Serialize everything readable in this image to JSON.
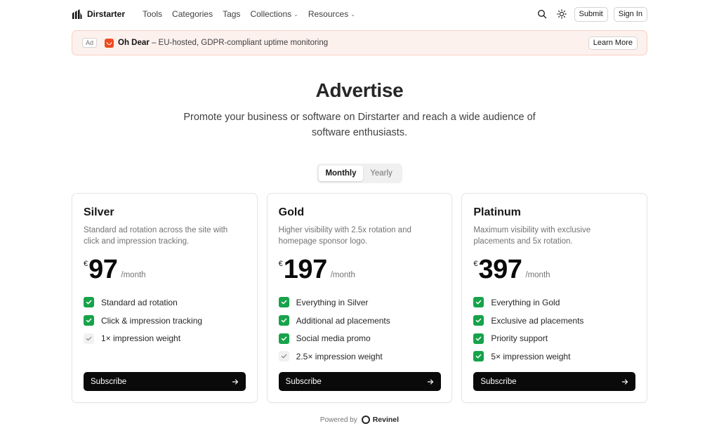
{
  "header": {
    "brand": "Dirstarter",
    "nav": [
      {
        "label": "Tools",
        "dropdown": false
      },
      {
        "label": "Categories",
        "dropdown": false
      },
      {
        "label": "Tags",
        "dropdown": false
      },
      {
        "label": "Collections",
        "dropdown": true
      },
      {
        "label": "Resources",
        "dropdown": true
      }
    ],
    "submit_label": "Submit",
    "signin_label": "Sign In",
    "icons": [
      "search-icon",
      "theme-sun-icon"
    ]
  },
  "ad": {
    "badge": "Ad",
    "name": "Oh Dear",
    "text": " – EU-hosted, GDPR-compliant uptime monitoring",
    "cta": "Learn More",
    "logo_color": "#ef4b21"
  },
  "hero": {
    "title": "Advertise",
    "subtitle": "Promote your business or software on Dirstarter and reach a wide audience of software enthusiasts."
  },
  "billing": {
    "options": [
      "Monthly",
      "Yearly"
    ],
    "selected": "Monthly"
  },
  "plans": [
    {
      "name": "Silver",
      "description": "Standard ad rotation across the site with click and impression tracking.",
      "currency": "€",
      "price": "97",
      "period": "/month",
      "features": [
        {
          "text": "Standard ad rotation",
          "highlighted": true
        },
        {
          "text": "Click & impression tracking",
          "highlighted": true
        },
        {
          "text": "1× impression weight",
          "highlighted": false
        }
      ],
      "cta": "Subscribe"
    },
    {
      "name": "Gold",
      "description": "Higher visibility with 2.5x rotation and homepage sponsor logo.",
      "currency": "€",
      "price": "197",
      "period": "/month",
      "features": [
        {
          "text": "Everything in Silver",
          "highlighted": true
        },
        {
          "text": "Additional ad placements",
          "highlighted": true
        },
        {
          "text": "Social media promo",
          "highlighted": true
        },
        {
          "text": "2.5× impression weight",
          "highlighted": false
        }
      ],
      "cta": "Subscribe"
    },
    {
      "name": "Platinum",
      "description": "Maximum visibility with exclusive placements and 5x rotation.",
      "currency": "€",
      "price": "397",
      "period": "/month",
      "features": [
        {
          "text": "Everything in Gold",
          "highlighted": true
        },
        {
          "text": "Exclusive ad placements",
          "highlighted": true
        },
        {
          "text": "Priority support",
          "highlighted": true
        },
        {
          "text": "5× impression weight",
          "highlighted": true
        }
      ],
      "cta": "Subscribe"
    }
  ],
  "footer": {
    "powered_by": "Powered by",
    "provider": "Revinel"
  },
  "colors": {
    "accent_check": "#16a34a",
    "button_dark": "#0a0a0a",
    "ad_background": "#fdf1ee",
    "ad_border": "#fbcfc2"
  }
}
